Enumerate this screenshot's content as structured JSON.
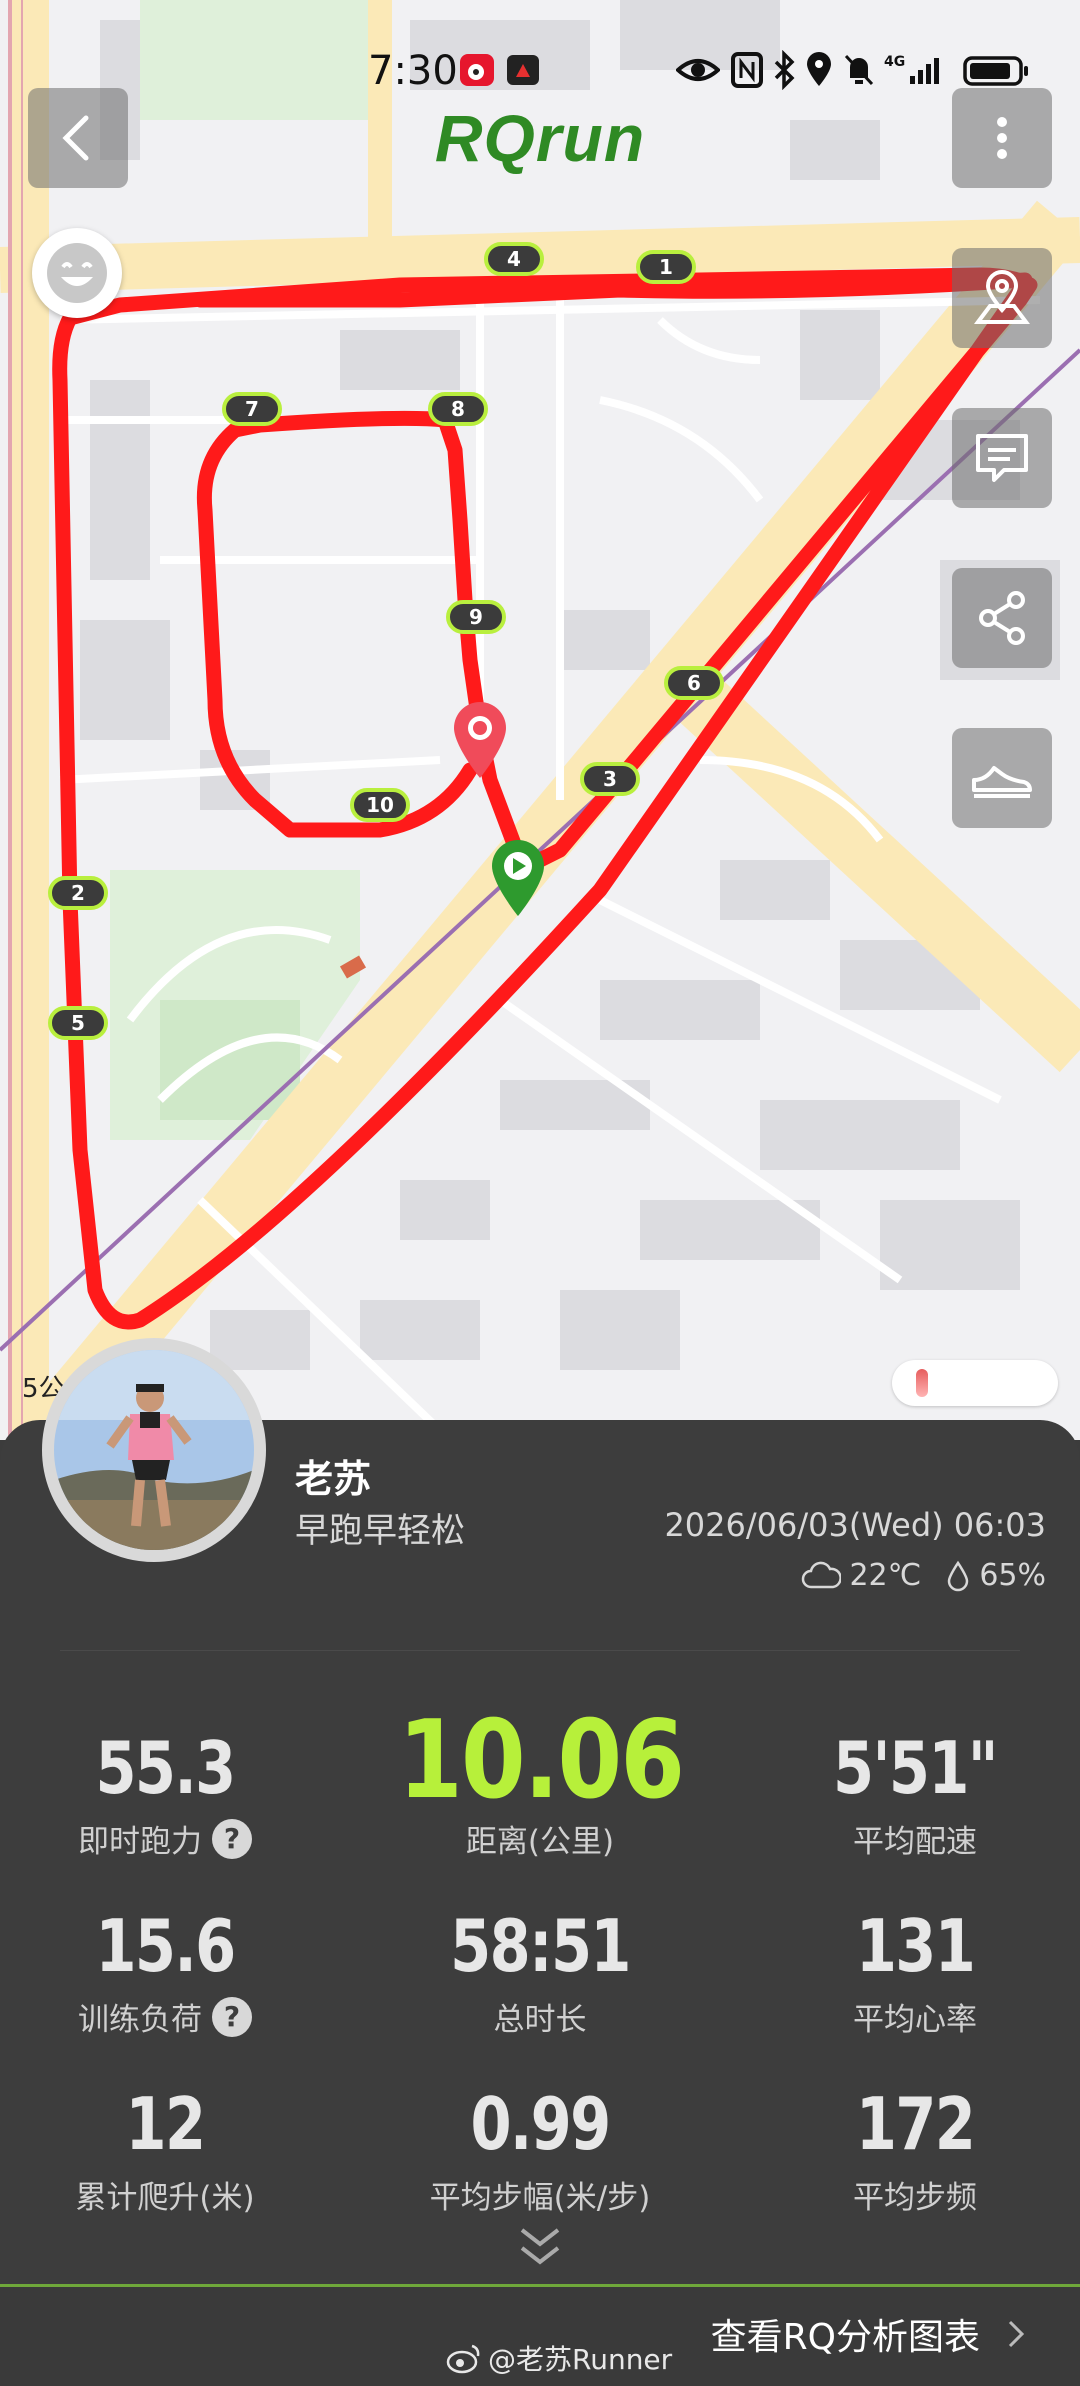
{
  "status_bar": {
    "time": "7:30",
    "network": "4G"
  },
  "app": {
    "brand": "RQrun"
  },
  "map": {
    "scale_label": "5公",
    "km_markers": [
      "1",
      "2",
      "3",
      "4",
      "5",
      "6",
      "7",
      "8",
      "9",
      "10"
    ]
  },
  "profile": {
    "name": "老苏",
    "motto": "早跑早轻松",
    "datetime": "2026/06/03(Wed) 06:03",
    "temperature": "22℃",
    "humidity": "65%"
  },
  "stats": [
    {
      "value": "55.3",
      "label": "即时跑力",
      "help": "?"
    },
    {
      "value": "10.06",
      "label": "距离(公里)"
    },
    {
      "value": "5'51\"",
      "label": "平均配速"
    },
    {
      "value": "15.6",
      "label": "训练负荷",
      "help": "?"
    },
    {
      "value": "58:51",
      "label": "总时长"
    },
    {
      "value": "131",
      "label": "平均心率"
    },
    {
      "value": "12",
      "label": "累计爬升(米)"
    },
    {
      "value": "0.99",
      "label": "平均步幅(米/步)"
    },
    {
      "value": "172",
      "label": "平均步频"
    }
  ],
  "footer": {
    "analysis_link": "查看RQ分析图表",
    "watermark": "@老苏Runner"
  },
  "colors": {
    "route": "#ff1a1a",
    "brand": "#2f8a24",
    "highlight": "#b7f03a",
    "panel": "#3d3d3d"
  }
}
